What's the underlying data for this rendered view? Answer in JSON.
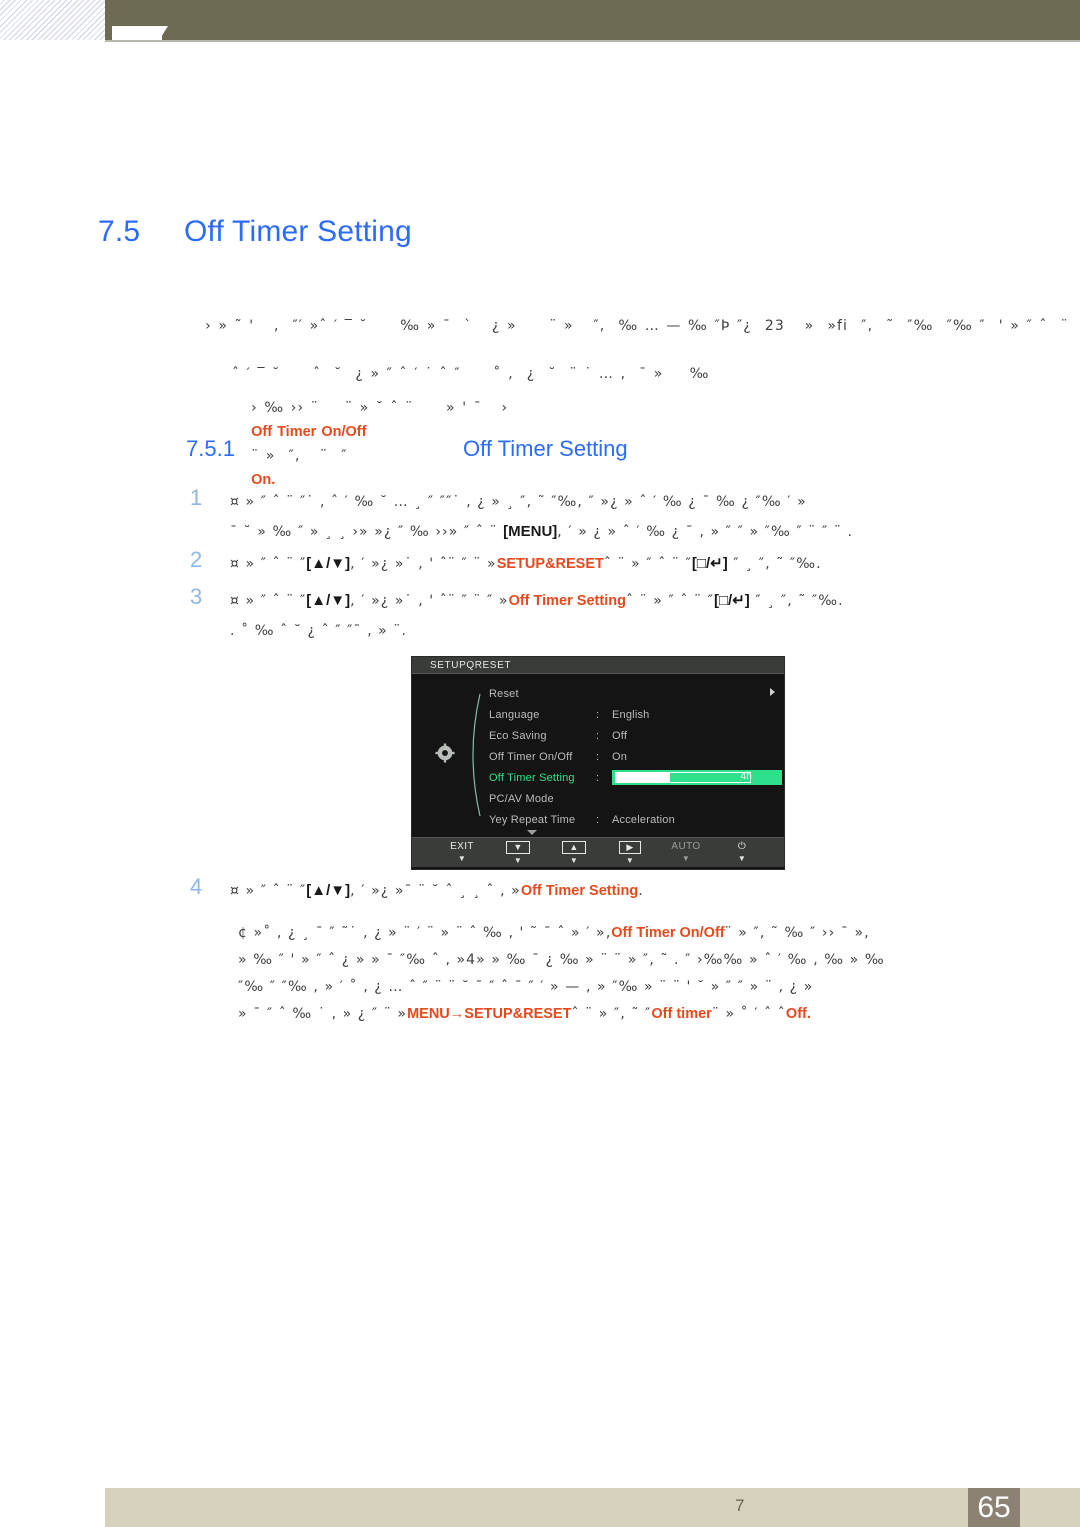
{
  "header": {
    "bar_color": "#6e6b55",
    "hatch_accent": "#c9d4ea"
  },
  "heading": {
    "number": "7.5",
    "title": "Off Timer Setting"
  },
  "subheading": {
    "number": "7.5.1",
    "title": "Off Timer Setting"
  },
  "intro": {
    "line1": "› » ˜ '   ‚  ″′ »ˆ ′ ‾ ˘     ‰ » ˉ  `   ¿ »     ¨ »   ″‚  ‰ … — ‰ ″Þ ″¿  23   »  »fi  ″‚  ˜  ″‰  ″‰ ″  ' » ″ ˆ  ¨",
    "line2": "ˆ ′ ‾ ˘     ˆ  ˘  ¿ » ″ ˆ ′ ˙ ˆ ″     ˚ ‚  ¿  ˘  ¨ ˙ … ‚  ˉ »    ‰"
  },
  "note1": {
    "prefix": "› ‰ ›› ¨    ¨ » ˘ ˆ ¨     » ' ˉ   ›",
    "term": "Off Timer On/Off",
    "middle": "¨ »  ″‚   ¨  ″",
    "suffix": "On.",
    "accent_color": "#e8491c"
  },
  "steps": [
    {
      "num": "1",
      "line1_pre": "¤ » ″ ˆ ¨ ″˙ ‚ ˆ ′ ‰ ˘ … ¸ ″ ″″˙ ‚ ¿ » ¸ ″‚ ˜ ″‰, ″ »¿ »  ˆ ′ ‰  ¿  ˉ ‰  ¿  ″‰ ′ »",
      "line2_pre": "ˉ ˘ » ‰ ″ » ¸ ¸ ›» »¿ ″ ‰ ››» ″ ˆ ¨ ",
      "key": "[MENU]",
      "line2_post": ", ′ » ¿ »   ˆ ′ ‰  ¿ ˉ ‚ » ″ ″ »   ″‰ ″ ¨ ″ ¨ ."
    },
    {
      "num": "2",
      "pre": "¤ » ″ ˆ ¨ ″",
      "key1": "[▲/▼]",
      "mid1": ", ′ »¿ »˙ ‚ ' ˆ¨ ″ ¨ »",
      "term": "SETUP&RESET",
      "mid2": "ˆ ¨ » ″ ˆ ¨ ″",
      "key2": "[□/↵]",
      "post": " ″ ¸ ″‚ ˜ ″‰."
    },
    {
      "num": "3",
      "pre": "¤ » ″ ˆ ¨ ″",
      "key1": "[▲/▼]",
      "mid1": ", ′ »¿ »˙ ‚ ' ˆ¨ ″ ¨ ″ »",
      "term": "Off Timer Setting",
      "mid2": "ˆ ¨ » ″ ˆ ¨ ″",
      "key2": "[□/↵]",
      "post": " ″ ¸ ″‚ ˜ ″‰.",
      "line2": ".    ˚  ‰ ˆ ˘ ¿ ˆ ″ ″ˉ ‚ » ¨."
    },
    {
      "num": "4",
      "pre": "¤ » ″ ˆ ¨ ″",
      "key1": "[▲/▼]",
      "mid1": ", ′ »¿ »ˉ ¨ ˘ ˆ ¸ ¸ ˆ ‚ »",
      "term": "Off Timer Setting",
      "post": "."
    }
  ],
  "note2": {
    "line1_pre": "¢ »˚ ‚ ¿ ¸ ˉ ″ ˜˙ ‚ ¿ » ¨ ′ ¨ »  ¨ ˆ ‰ ‚ ' ˜ ˉ ˆ » ′ »‚",
    "line1_term": "Off Timer On/Off",
    "line1_post": "¨ » ″‚ ˜ ‰ ″ ›› ˉ »‚",
    "line2_pre": "» ‰ ″ ' » ″ ˆ ¿ »  » ˉ ″‰ ˆ ‚ »",
    "line2_num": "4",
    "line2_post": "»  » ‰ ˉ ¿  ‰ » ¨  ¨ »  ″‚ ˜ . ″ ›‰‰ » ˆ ′ ‰  ‚ ‰ » ‰",
    "line3": "″‰ ″ ″‰ ‚ » ′ ˚ ‚ ¿ … ˆ ″ ¨  ¨  ˘ ˉ ″ ˆ   ˉ ″ ′ » — ‚ » ″‰ » ¨ ¨ ' ˘  » ″ ″ » ¨ ‚ ¿ »",
    "line4_pre": "» ˉ ″ ˆ ‰ ˙ ‚ » ¿  ″ ¨ »",
    "line4_menu": "MENU",
    "line4_arrow": "→",
    "line4_setup": "SETUP&RESET",
    "line4_mid": "ˆ ¨ » ″‚ ˜ ″",
    "line4_term": "Off timer",
    "line4_mid2": "¨ » ˚ ′ ˆ ˆ",
    "line4_end": "Off."
  },
  "osd": {
    "title": "SETUPQRESET",
    "gear_icon": "gear-icon",
    "items": [
      {
        "label": "Reset",
        "value": "",
        "colon": "",
        "active": false,
        "kind": "plain"
      },
      {
        "label": "Language",
        "value": "English",
        "colon": ":",
        "active": false,
        "kind": "plain"
      },
      {
        "label": "Eco Saving",
        "value": "Off",
        "colon": ":",
        "active": false,
        "kind": "plain"
      },
      {
        "label": "Off Timer On/Off",
        "value": "On",
        "colon": ":",
        "active": false,
        "kind": "plain"
      },
      {
        "label": "Off Timer Setting",
        "value": "4h",
        "colon": ":",
        "active": true,
        "kind": "slider"
      },
      {
        "label": "PC/AV Mode",
        "value": "",
        "colon": "",
        "active": false,
        "kind": "submenu"
      },
      {
        "label": "Yey Repeat Time",
        "value": "Acceleration",
        "colon": ":",
        "active": false,
        "kind": "plain"
      }
    ],
    "slider": {
      "value_label": "4h",
      "fill_percent": 40
    },
    "highlight_color": "#2ee08a",
    "buttons": [
      {
        "label": "EXIT",
        "style": "text",
        "dim": false
      },
      {
        "label": "▼",
        "style": "key",
        "dim": false
      },
      {
        "label": "▲",
        "style": "key",
        "dim": false
      },
      {
        "label": "▶",
        "style": "key",
        "dim": false
      },
      {
        "label": "AUTO",
        "style": "text",
        "dim": true
      },
      {
        "label": "⏻",
        "style": "text",
        "dim": false
      }
    ],
    "button_tick": "▼"
  },
  "footer": {
    "chapter": "7",
    "page": "65",
    "bar_color": "#d6d2be",
    "page_box_color": "#8b8274"
  }
}
